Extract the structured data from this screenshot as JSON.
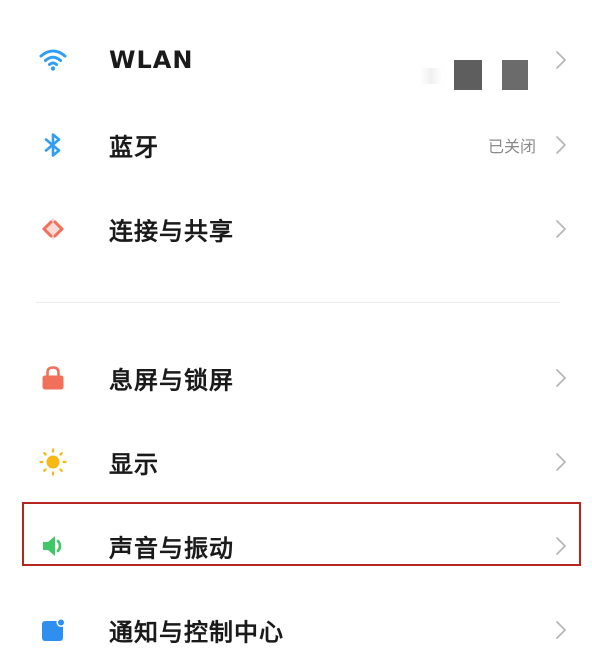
{
  "settings": {
    "items": [
      {
        "label": "WLAN",
        "status": "",
        "icon": "wifi-icon",
        "color": "#2f9ef4"
      },
      {
        "label": "蓝牙",
        "status": "已关闭",
        "icon": "bluetooth-icon",
        "color": "#2f9ef4"
      },
      {
        "label": "连接与共享",
        "status": "",
        "icon": "connection-share-icon",
        "color": "#f0705a"
      },
      {
        "label": "息屏与锁屏",
        "status": "",
        "icon": "lock-icon",
        "color": "#f0705a"
      },
      {
        "label": "显示",
        "status": "",
        "icon": "sun-icon",
        "color": "#f6b814"
      },
      {
        "label": "声音与振动",
        "status": "",
        "icon": "speaker-icon",
        "color": "#3fc768"
      },
      {
        "label": "通知与控制中心",
        "status": "",
        "icon": "notification-icon",
        "color": "#2f8ff0"
      }
    ]
  },
  "colors": {
    "highlight_border": "#b5261f",
    "chevron": "#b8b8b8",
    "divider": "#ececec"
  }
}
